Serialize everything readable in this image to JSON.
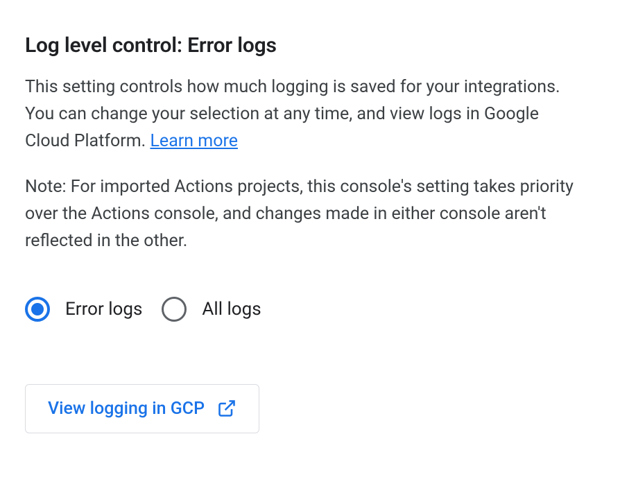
{
  "heading": "Log level control: Error logs",
  "description_text": "This setting controls how much logging is saved for your integrations. You can change your selection at any time, and view logs in Google Cloud Platform. ",
  "learn_more_label": "Learn more",
  "note_text": "Note: For imported Actions projects, this console's setting takes priority over the Actions console, and changes made in either console aren't reflected in the other.",
  "radio": {
    "options": [
      {
        "label": "Error logs",
        "selected": true
      },
      {
        "label": "All logs",
        "selected": false
      }
    ]
  },
  "gcp_button_label": "View logging in GCP",
  "colors": {
    "link_blue": "#1a73e8",
    "text_primary": "#202124",
    "text_secondary": "#3c4043",
    "border_gray": "#dadce0",
    "radio_unselected": "#5f6368"
  }
}
